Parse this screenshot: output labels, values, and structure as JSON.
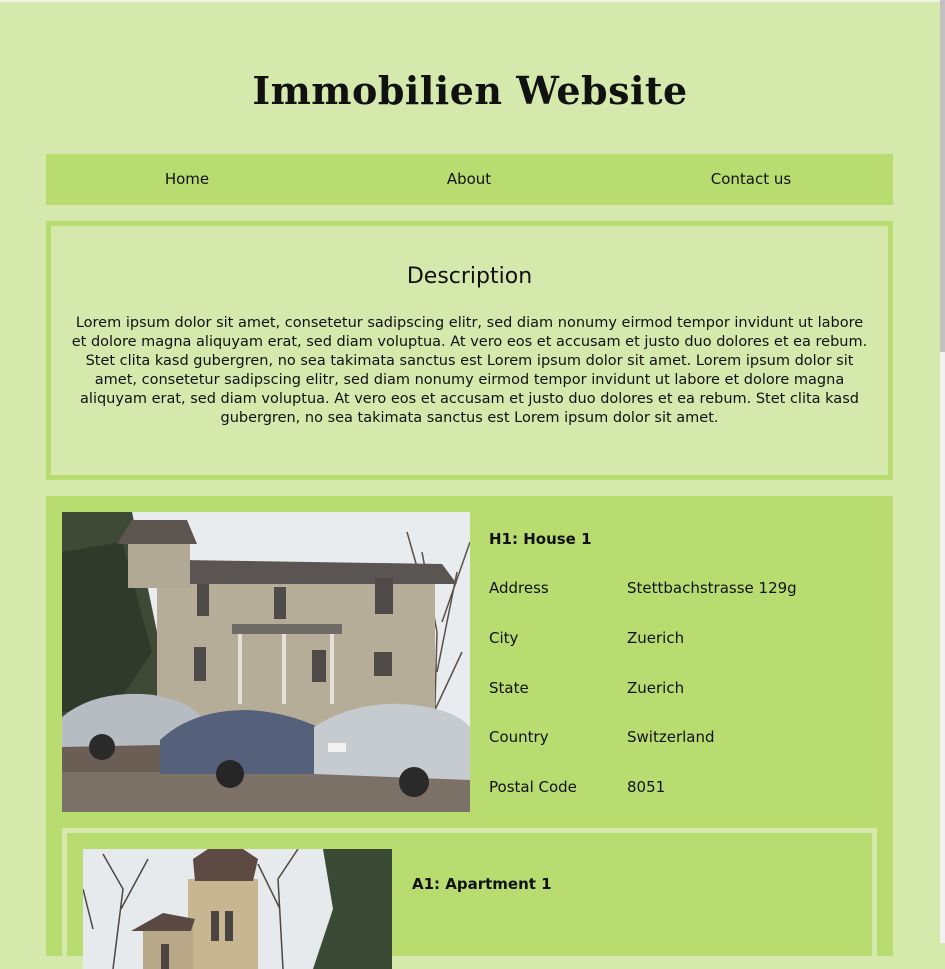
{
  "site": {
    "title": "Immobilien Website"
  },
  "nav": {
    "items": [
      {
        "label": "Home"
      },
      {
        "label": "About"
      },
      {
        "label": "Contact us"
      }
    ]
  },
  "description": {
    "heading": "Description",
    "text": "Lorem ipsum dolor sit amet, consetetur sadipscing elitr, sed diam nonumy eirmod tempor invidunt ut labore et dolore magna aliquyam erat, sed diam voluptua. At vero eos et accusam et justo duo dolores et ea rebum. Stet clita kasd gubergren, no sea takimata sanctus est Lorem ipsum dolor sit amet. Lorem ipsum dolor sit amet, consetetur sadipscing elitr, sed diam nonumy eirmod tempor invidunt ut labore et dolore magna aliquyam erat, sed diam voluptua. At vero eos et accusam et justo duo dolores et ea rebum. Stet clita kasd gubergren, no sea takimata sanctus est Lorem ipsum dolor sit amet."
  },
  "house": {
    "title": "H1: House 1",
    "fields": [
      {
        "label": "Address",
        "value": "Stettbachstrasse 129g"
      },
      {
        "label": "City",
        "value": "Zuerich"
      },
      {
        "label": "State",
        "value": "Zuerich"
      },
      {
        "label": "Country",
        "value": "Switzerland"
      },
      {
        "label": "Postal Code",
        "value": "8051"
      }
    ]
  },
  "apartment": {
    "title": "A1: Apartment 1"
  },
  "colors": {
    "page_bg": "#d6e9ad",
    "accent": "#b8dc70"
  }
}
